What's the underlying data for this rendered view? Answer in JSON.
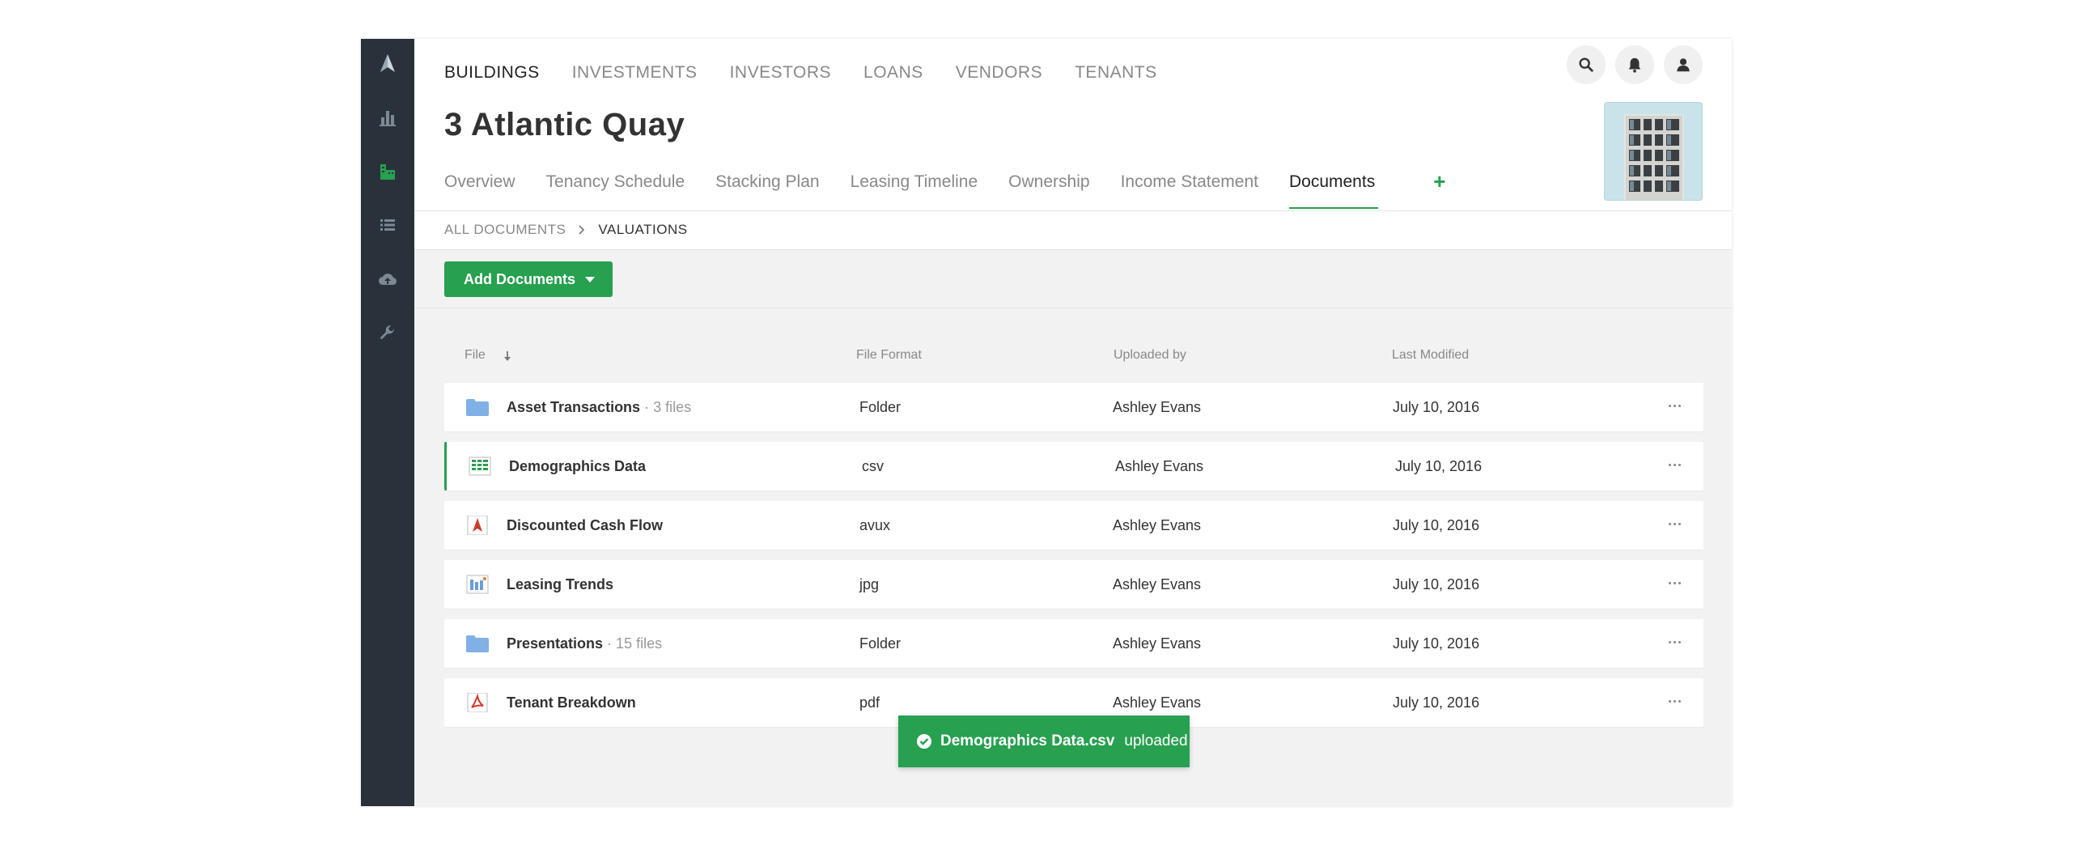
{
  "top_nav": {
    "items": [
      {
        "label": "BUILDINGS",
        "active": true
      },
      {
        "label": "INVESTMENTS",
        "active": false
      },
      {
        "label": "INVESTORS",
        "active": false
      },
      {
        "label": "LOANS",
        "active": false
      },
      {
        "label": "VENDORS",
        "active": false
      },
      {
        "label": "TENANTS",
        "active": false
      }
    ]
  },
  "sidebar": {
    "icons": [
      "logo-icon",
      "chart-icon",
      "buildings-icon",
      "list-icon",
      "cloud-upload-icon",
      "wrench-icon"
    ],
    "active_icon": "buildings-icon"
  },
  "header": {
    "title": "3 Atlantic Quay"
  },
  "tabs": [
    {
      "label": "Overview"
    },
    {
      "label": "Tenancy Schedule"
    },
    {
      "label": "Stacking Plan"
    },
    {
      "label": "Leasing Timeline"
    },
    {
      "label": "Ownership"
    },
    {
      "label": "Income Statement"
    },
    {
      "label": "Documents",
      "active": true
    }
  ],
  "tab_add_label": "+",
  "breadcrumb": {
    "root": "ALL DOCUMENTS",
    "current": "VALUATIONS"
  },
  "toolbar": {
    "add_label": "Add Documents"
  },
  "table": {
    "headers": {
      "file": "File",
      "format": "File Format",
      "uploaded_by": "Uploaded by",
      "modified": "Last Modified"
    },
    "rows": [
      {
        "icon": "folder-icon",
        "name": "Asset Transactions",
        "count": "· 3 files",
        "format": "Folder",
        "uploaded_by": "Ashley Evans",
        "modified": "July 10, 2016"
      },
      {
        "icon": "spreadsheet-icon",
        "name": "Demographics Data",
        "count": "",
        "format": "csv",
        "uploaded_by": "Ashley Evans",
        "modified": "July 10, 2016",
        "selected": true
      },
      {
        "icon": "avux-icon",
        "name": "Discounted Cash Flow",
        "count": "",
        "format": "avux",
        "uploaded_by": "Ashley Evans",
        "modified": "July 10, 2016"
      },
      {
        "icon": "image-icon",
        "name": "Leasing Trends",
        "count": "",
        "format": "jpg",
        "uploaded_by": "Ashley Evans",
        "modified": "July 10, 2016"
      },
      {
        "icon": "folder-icon",
        "name": "Presentations",
        "count": "· 15 files",
        "format": "Folder",
        "uploaded_by": "Ashley Evans",
        "modified": "July 10, 2016"
      },
      {
        "icon": "pdf-icon",
        "name": "Tenant Breakdown",
        "count": "",
        "format": "pdf",
        "uploaded_by": "Ashley Evans",
        "modified": "July 10, 2016"
      }
    ]
  },
  "toast": {
    "file": "Demographics Data.csv",
    "status": "uploaded"
  },
  "colors": {
    "accent": "#27a04f",
    "rail": "#29323b",
    "folder": "#7fb0e6"
  }
}
